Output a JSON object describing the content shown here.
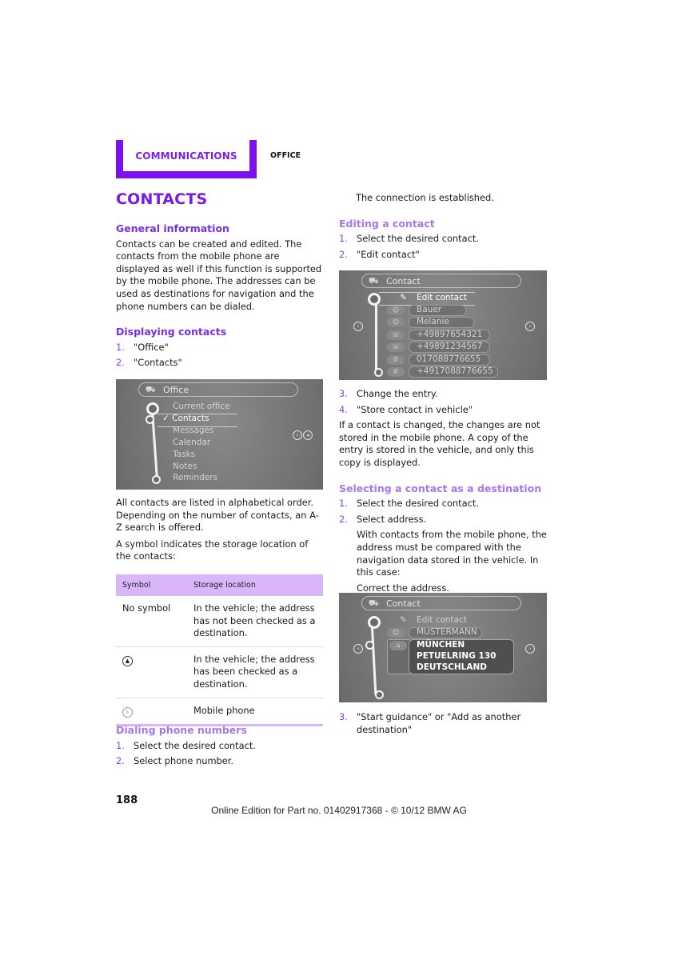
{
  "header": {
    "section_tab": "COMMUNICATIONS",
    "subsection": "OFFICE",
    "accent_color": "#7d0ff0"
  },
  "page_title": "CONTACTS",
  "left_column": {
    "general": {
      "heading": "General information",
      "body": "Contacts can be created and edited. The contacts from the mobile phone are displayed as well if this function is supported by the mobile phone. The addresses can be used as destinations for navigation and the phone numbers can be dialed."
    },
    "displaying": {
      "heading": "Displaying contacts",
      "steps": [
        {
          "num": "1.",
          "text": "\"Office\""
        },
        {
          "num": "2.",
          "text": "\"Contacts\""
        }
      ]
    },
    "screen_office": {
      "title": "Office",
      "title_icon": "car-list-icon",
      "items": [
        "Current office",
        "✓ Contacts",
        "Messages",
        "Calendar",
        "Tasks",
        "Notes",
        "Reminders"
      ],
      "selected_index": 1
    },
    "after_screen": [
      "All contacts are listed in alphabetical order. Depending on the number of contacts, an A-Z search is offered.",
      "A symbol indicates the storage location of the contacts:"
    ],
    "table": {
      "headers": [
        "Symbol",
        "Storage location"
      ],
      "rows": [
        {
          "symbol": "No symbol",
          "symbol_icon": "",
          "location": "In the vehicle; the address has not been checked as a destination."
        },
        {
          "symbol": "",
          "symbol_icon": "checked-destination-icon",
          "location": "In the vehicle; the address has been checked as a destination."
        },
        {
          "symbol": "",
          "symbol_icon": "mobile-phone-icon",
          "location": "Mobile phone"
        }
      ]
    },
    "dialing": {
      "heading": "Dialing phone numbers",
      "steps": [
        {
          "num": "1.",
          "text": "Select the desired contact."
        },
        {
          "num": "2.",
          "text": "Select phone number."
        }
      ]
    }
  },
  "right_column": {
    "connection_text": "The connection is established.",
    "editing": {
      "heading": "Editing a contact",
      "steps": [
        {
          "num": "1.",
          "text": "Select the desired contact."
        },
        {
          "num": "2.",
          "text": "\"Edit contact\""
        }
      ]
    },
    "screen_contact_edit": {
      "title": "Contact",
      "items": [
        "Edit contact",
        "Bauer",
        "Melanie",
        "+49897654321",
        "+49891234567",
        "017088776655",
        "+4917088776655"
      ]
    },
    "editing_steps_2": [
      {
        "num": "3.",
        "text": "Change the entry."
      },
      {
        "num": "4.",
        "text": "\"Store contact in vehicle\""
      }
    ],
    "editing_note": "If a contact is changed, the changes are not stored in the mobile phone. A copy of the entry is stored in the vehicle, and only this copy is displayed.",
    "destination": {
      "heading": "Selecting a contact as a destination",
      "steps": [
        {
          "num": "1.",
          "text": "Select the desired contact."
        },
        {
          "num": "2.",
          "text": "Select address."
        }
      ],
      "step2_detail": "With contacts from the mobile phone, the address must be compared with the navigation data stored in the vehicle. In this case:",
      "step2_detail_2": "Correct the address."
    },
    "screen_contact_address": {
      "title": "Contact",
      "items": [
        "Edit contact",
        "MUSTERMANN"
      ],
      "address_lines": [
        "MÜNCHEN",
        "PETUELRING 130",
        "DEUTSCHLAND"
      ]
    },
    "final_step": {
      "num": "3.",
      "text": "\"Start guidance\" or \"Add as another destination\""
    }
  },
  "page_number": "188",
  "footer": "Online Edition for Part no. 01402917368 - © 10/12 BMW AG"
}
